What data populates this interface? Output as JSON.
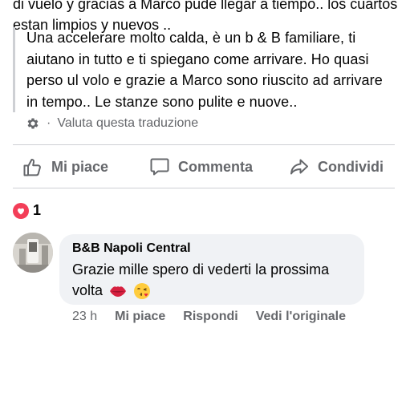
{
  "post": {
    "original_text": "di vuelo y gracias a Marco pude llegar a tiempo.. los cuartos estan limpios y nuevos ..",
    "translated_text": "Una accelerare molto calda, è un b & B familiare, ti aiutano in tutto e ti spiegano come arrivare. Ho quasi perso ul volo e grazie a Marco sono riuscito ad arrivare in tempo.. Le stanze sono pulite e nuove..",
    "rate_translation": "Valuta questa traduzione",
    "separator": "·"
  },
  "actions": {
    "like": "Mi piace",
    "comment": "Commenta",
    "share": "Condividi"
  },
  "reactions": {
    "count": "1",
    "type": "love"
  },
  "comment": {
    "author": "B&B Napoli Central",
    "text": "Grazie mille spero di vederti la prossima volta",
    "emojis": [
      "lips",
      "face-blowing-kiss"
    ],
    "time": "23 h",
    "like": "Mi piace",
    "reply": "Rispondi",
    "see_original": "Vedi l'originale"
  },
  "colors": {
    "secondary_text": "#65676b",
    "bubble": "#f0f2f5",
    "heart": "#f33e58",
    "divider": "#ced0d4"
  }
}
